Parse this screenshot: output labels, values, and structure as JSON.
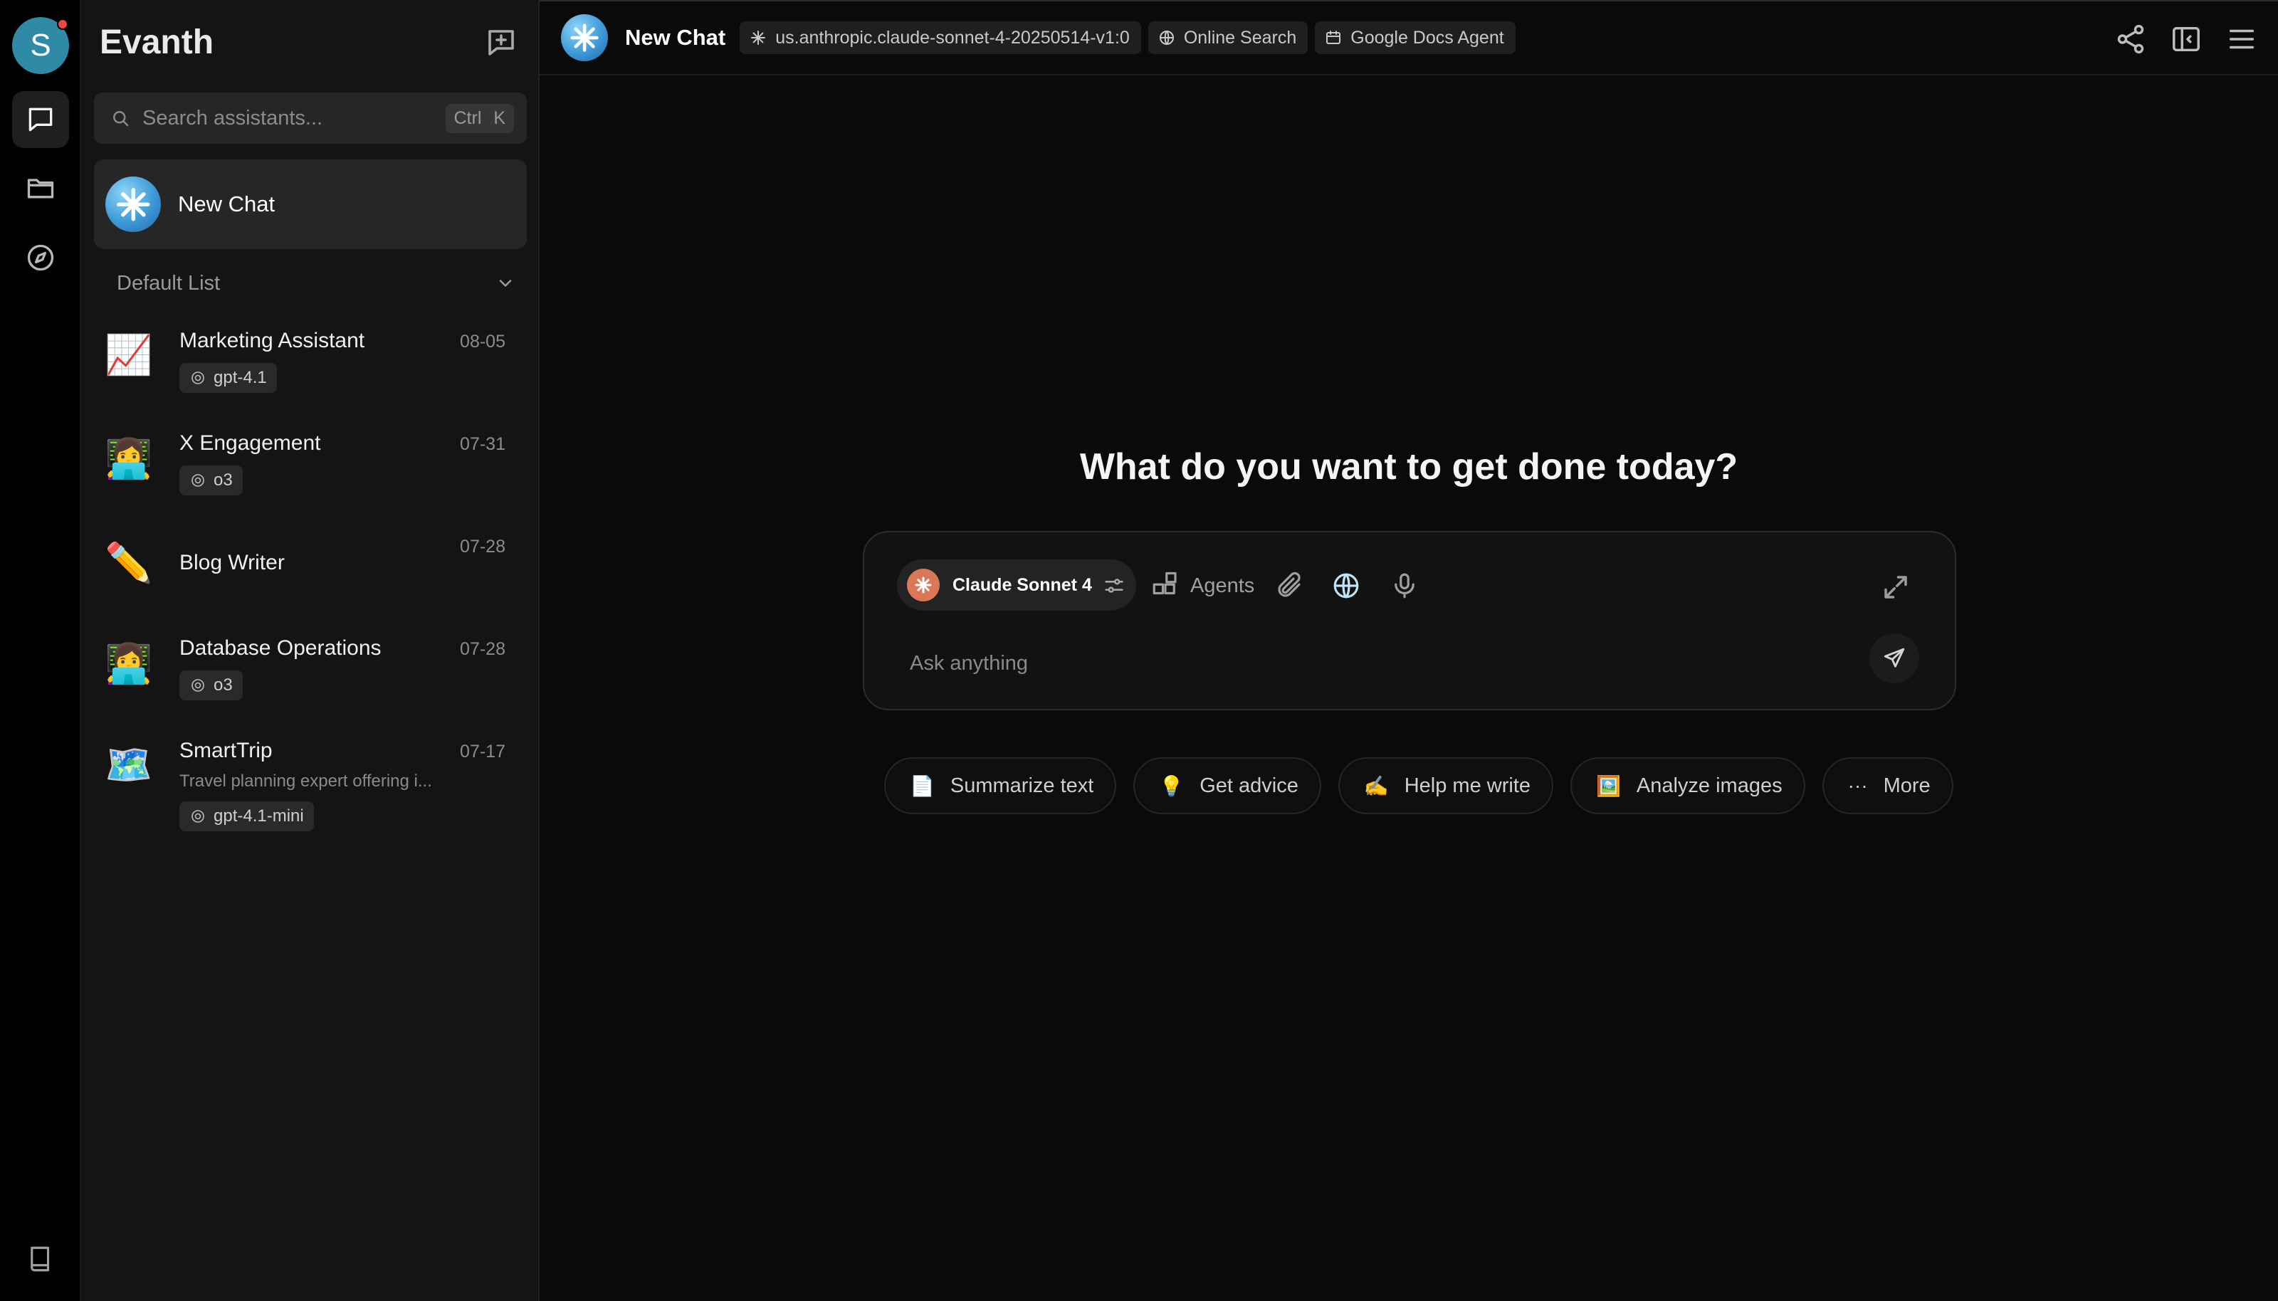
{
  "rail": {
    "avatar_letter": "S",
    "icons": [
      "chat-icon",
      "folder-icon",
      "compass-icon",
      "book-icon"
    ]
  },
  "sidebar": {
    "brand": "Evanth",
    "search": {
      "placeholder": "Search assistants...",
      "shortcut": "Ctrl K"
    },
    "new_chat": "New Chat",
    "list_title": "Default List",
    "items": [
      {
        "name": "Marketing Assistant",
        "date": "08-05",
        "model": "gpt-4.1",
        "emoji": "📈",
        "description": ""
      },
      {
        "name": "X Engagement",
        "date": "07-31",
        "model": "o3",
        "emoji": "👩‍💻",
        "description": ""
      },
      {
        "name": "Blog Writer",
        "date": "07-28",
        "model": "",
        "emoji": "✏️",
        "description": ""
      },
      {
        "name": "Database Operations",
        "date": "07-28",
        "model": "o3",
        "emoji": "👩‍💻",
        "description": ""
      },
      {
        "name": "SmartTrip",
        "date": "07-17",
        "model": "gpt-4.1-mini",
        "emoji": "🗺️",
        "description": "Travel planning expert offering i..."
      }
    ]
  },
  "topbar": {
    "title": "New Chat",
    "model_chip": "us.anthropic.claude-sonnet-4-20250514-v1:0",
    "search_chip": "Online Search",
    "agent_chip": "Google Docs Agent"
  },
  "main": {
    "headline": "What do you want to get done today?",
    "composer": {
      "model": "Claude Sonnet 4",
      "agents_label": "Agents",
      "placeholder": "Ask anything"
    },
    "suggestions": [
      {
        "icon": "📄",
        "label": "Summarize text"
      },
      {
        "icon": "💡",
        "label": "Get advice"
      },
      {
        "icon": "✍️",
        "label": "Help me write"
      },
      {
        "icon": "🖼️",
        "label": "Analyze images"
      },
      {
        "icon": "···",
        "label": "More"
      }
    ]
  },
  "colors": {
    "accent_model": "#d97757",
    "avatar": "#2f8aa8",
    "background": "#0a0a0a"
  }
}
